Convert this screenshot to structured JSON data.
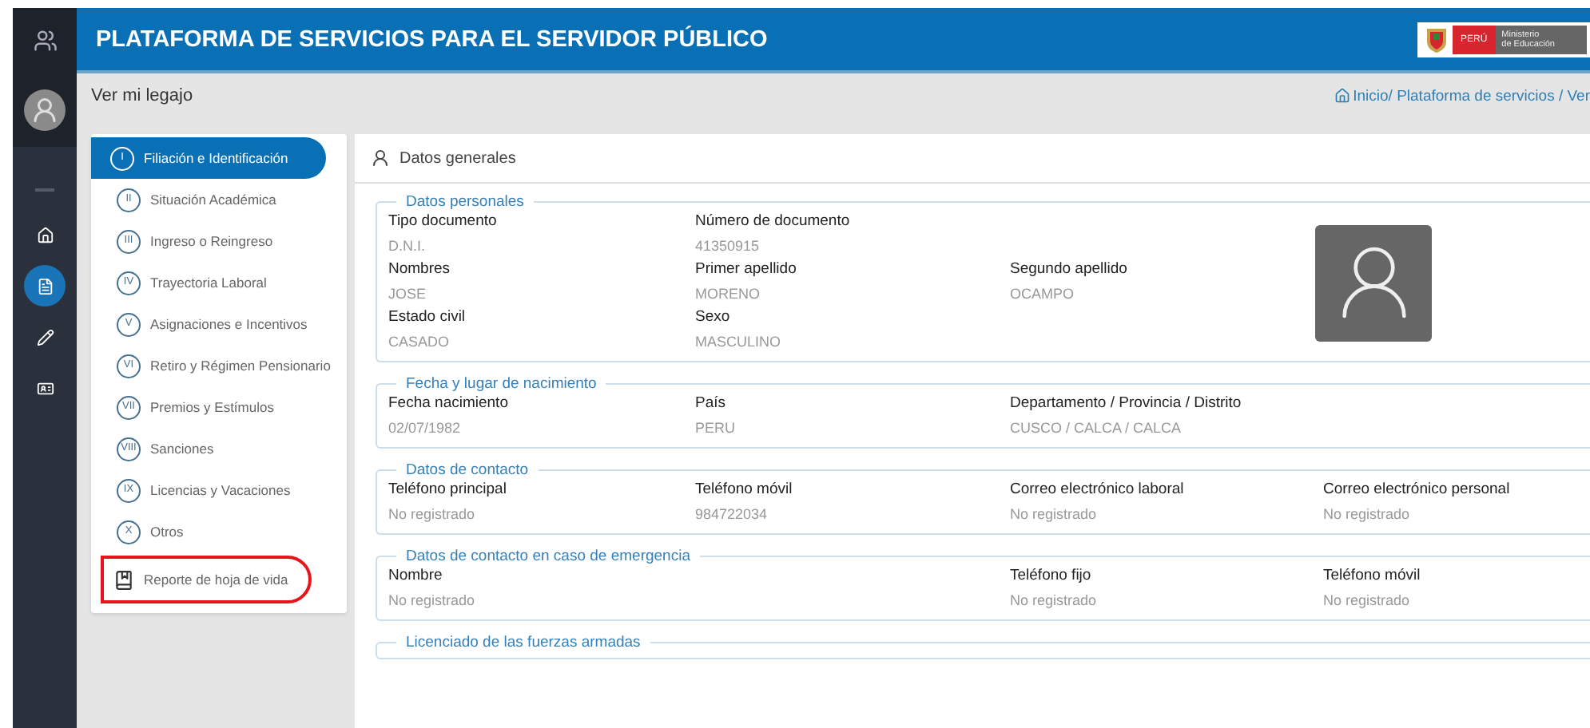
{
  "header": {
    "title": "PLATAFORMA DE SERVICIOS PARA EL SERVIDOR PÚBLICO",
    "logo": {
      "country": "PERÚ",
      "ministry": [
        "Ministerio",
        "de Educación"
      ]
    }
  },
  "rail": {
    "items": [
      {
        "kind": "home",
        "selected": false
      },
      {
        "kind": "document",
        "selected": true
      },
      {
        "kind": "edit",
        "selected": false
      },
      {
        "kind": "card",
        "selected": false
      }
    ]
  },
  "subheader": {
    "title": "Ver mi legajo",
    "breadcrumb": "Inicio/ Plataforma de servicios / Ver"
  },
  "menu": [
    {
      "numeral": "I",
      "label": "Filiación e Identificación",
      "selected": true,
      "kind": "section",
      "highlighted": false
    },
    {
      "numeral": "II",
      "label": "Situación Académica",
      "selected": false,
      "kind": "section",
      "highlighted": false
    },
    {
      "numeral": "III",
      "label": "Ingreso o Reingreso",
      "selected": false,
      "kind": "section",
      "highlighted": false
    },
    {
      "numeral": "IV",
      "label": "Trayectoria Laboral",
      "selected": false,
      "kind": "section",
      "highlighted": false
    },
    {
      "numeral": "V",
      "label": "Asignaciones e Incentivos",
      "selected": false,
      "kind": "section",
      "highlighted": false
    },
    {
      "numeral": "VI",
      "label": "Retiro y Régimen Pensionario",
      "selected": false,
      "kind": "section",
      "highlighted": false
    },
    {
      "numeral": "VII",
      "label": "Premios y Estímulos",
      "selected": false,
      "kind": "section",
      "highlighted": false
    },
    {
      "numeral": "VIII",
      "label": "Sanciones",
      "selected": false,
      "kind": "section",
      "highlighted": false
    },
    {
      "numeral": "IX",
      "label": "Licencias y Vacaciones",
      "selected": false,
      "kind": "section",
      "highlighted": false
    },
    {
      "numeral": "X",
      "label": "Otros",
      "selected": false,
      "kind": "section",
      "highlighted": false
    },
    {
      "label": "Reporte de hoja de vida",
      "selected": false,
      "kind": "report",
      "highlighted": true
    }
  ],
  "panel": {
    "title": "Datos generales",
    "sections": [
      {
        "title": "Datos personales",
        "photo": true,
        "rows": [
          [
            {
              "label": "Tipo documento",
              "value": "D.N.I."
            },
            {
              "label": "Número de documento",
              "value": "41350915"
            },
            null
          ],
          [
            {
              "label": "Nombres",
              "value": "JOSE"
            },
            {
              "label": "Primer apellido",
              "value": "MORENO"
            },
            {
              "label": "Segundo apellido",
              "value": "OCAMPO"
            }
          ],
          [
            {
              "label": "Estado civil",
              "value": "CASADO"
            },
            {
              "label": "Sexo",
              "value": "MASCULINO"
            },
            null
          ]
        ]
      },
      {
        "title": "Fecha y lugar de nacimiento",
        "photo": false,
        "rows": [
          [
            {
              "label": "Fecha nacimiento",
              "value": "02/07/1982"
            },
            {
              "label": "País",
              "value": "PERU"
            },
            {
              "label": "Departamento / Provincia / Distrito",
              "value": "CUSCO / CALCA / CALCA"
            }
          ]
        ]
      },
      {
        "title": "Datos de contacto",
        "photo": false,
        "rows": [
          [
            {
              "label": "Teléfono principal",
              "value": "No registrado"
            },
            {
              "label": "Teléfono móvil",
              "value": "984722034"
            },
            {
              "label": "Correo electrónico laboral",
              "value": "No registrado"
            },
            {
              "label": "Correo electrónico personal",
              "value": "No registrado"
            }
          ]
        ]
      },
      {
        "title": "Datos de contacto en caso de emergencia",
        "photo": false,
        "rows": [
          [
            {
              "label": "Nombre",
              "value": "No registrado"
            },
            null,
            {
              "label": "Teléfono fijo",
              "value": "No registrado"
            },
            {
              "label": "Teléfono móvil",
              "value": "No registrado"
            }
          ]
        ]
      },
      {
        "title": "Licenciado de las fuerzas armadas",
        "photo": false
      }
    ]
  }
}
